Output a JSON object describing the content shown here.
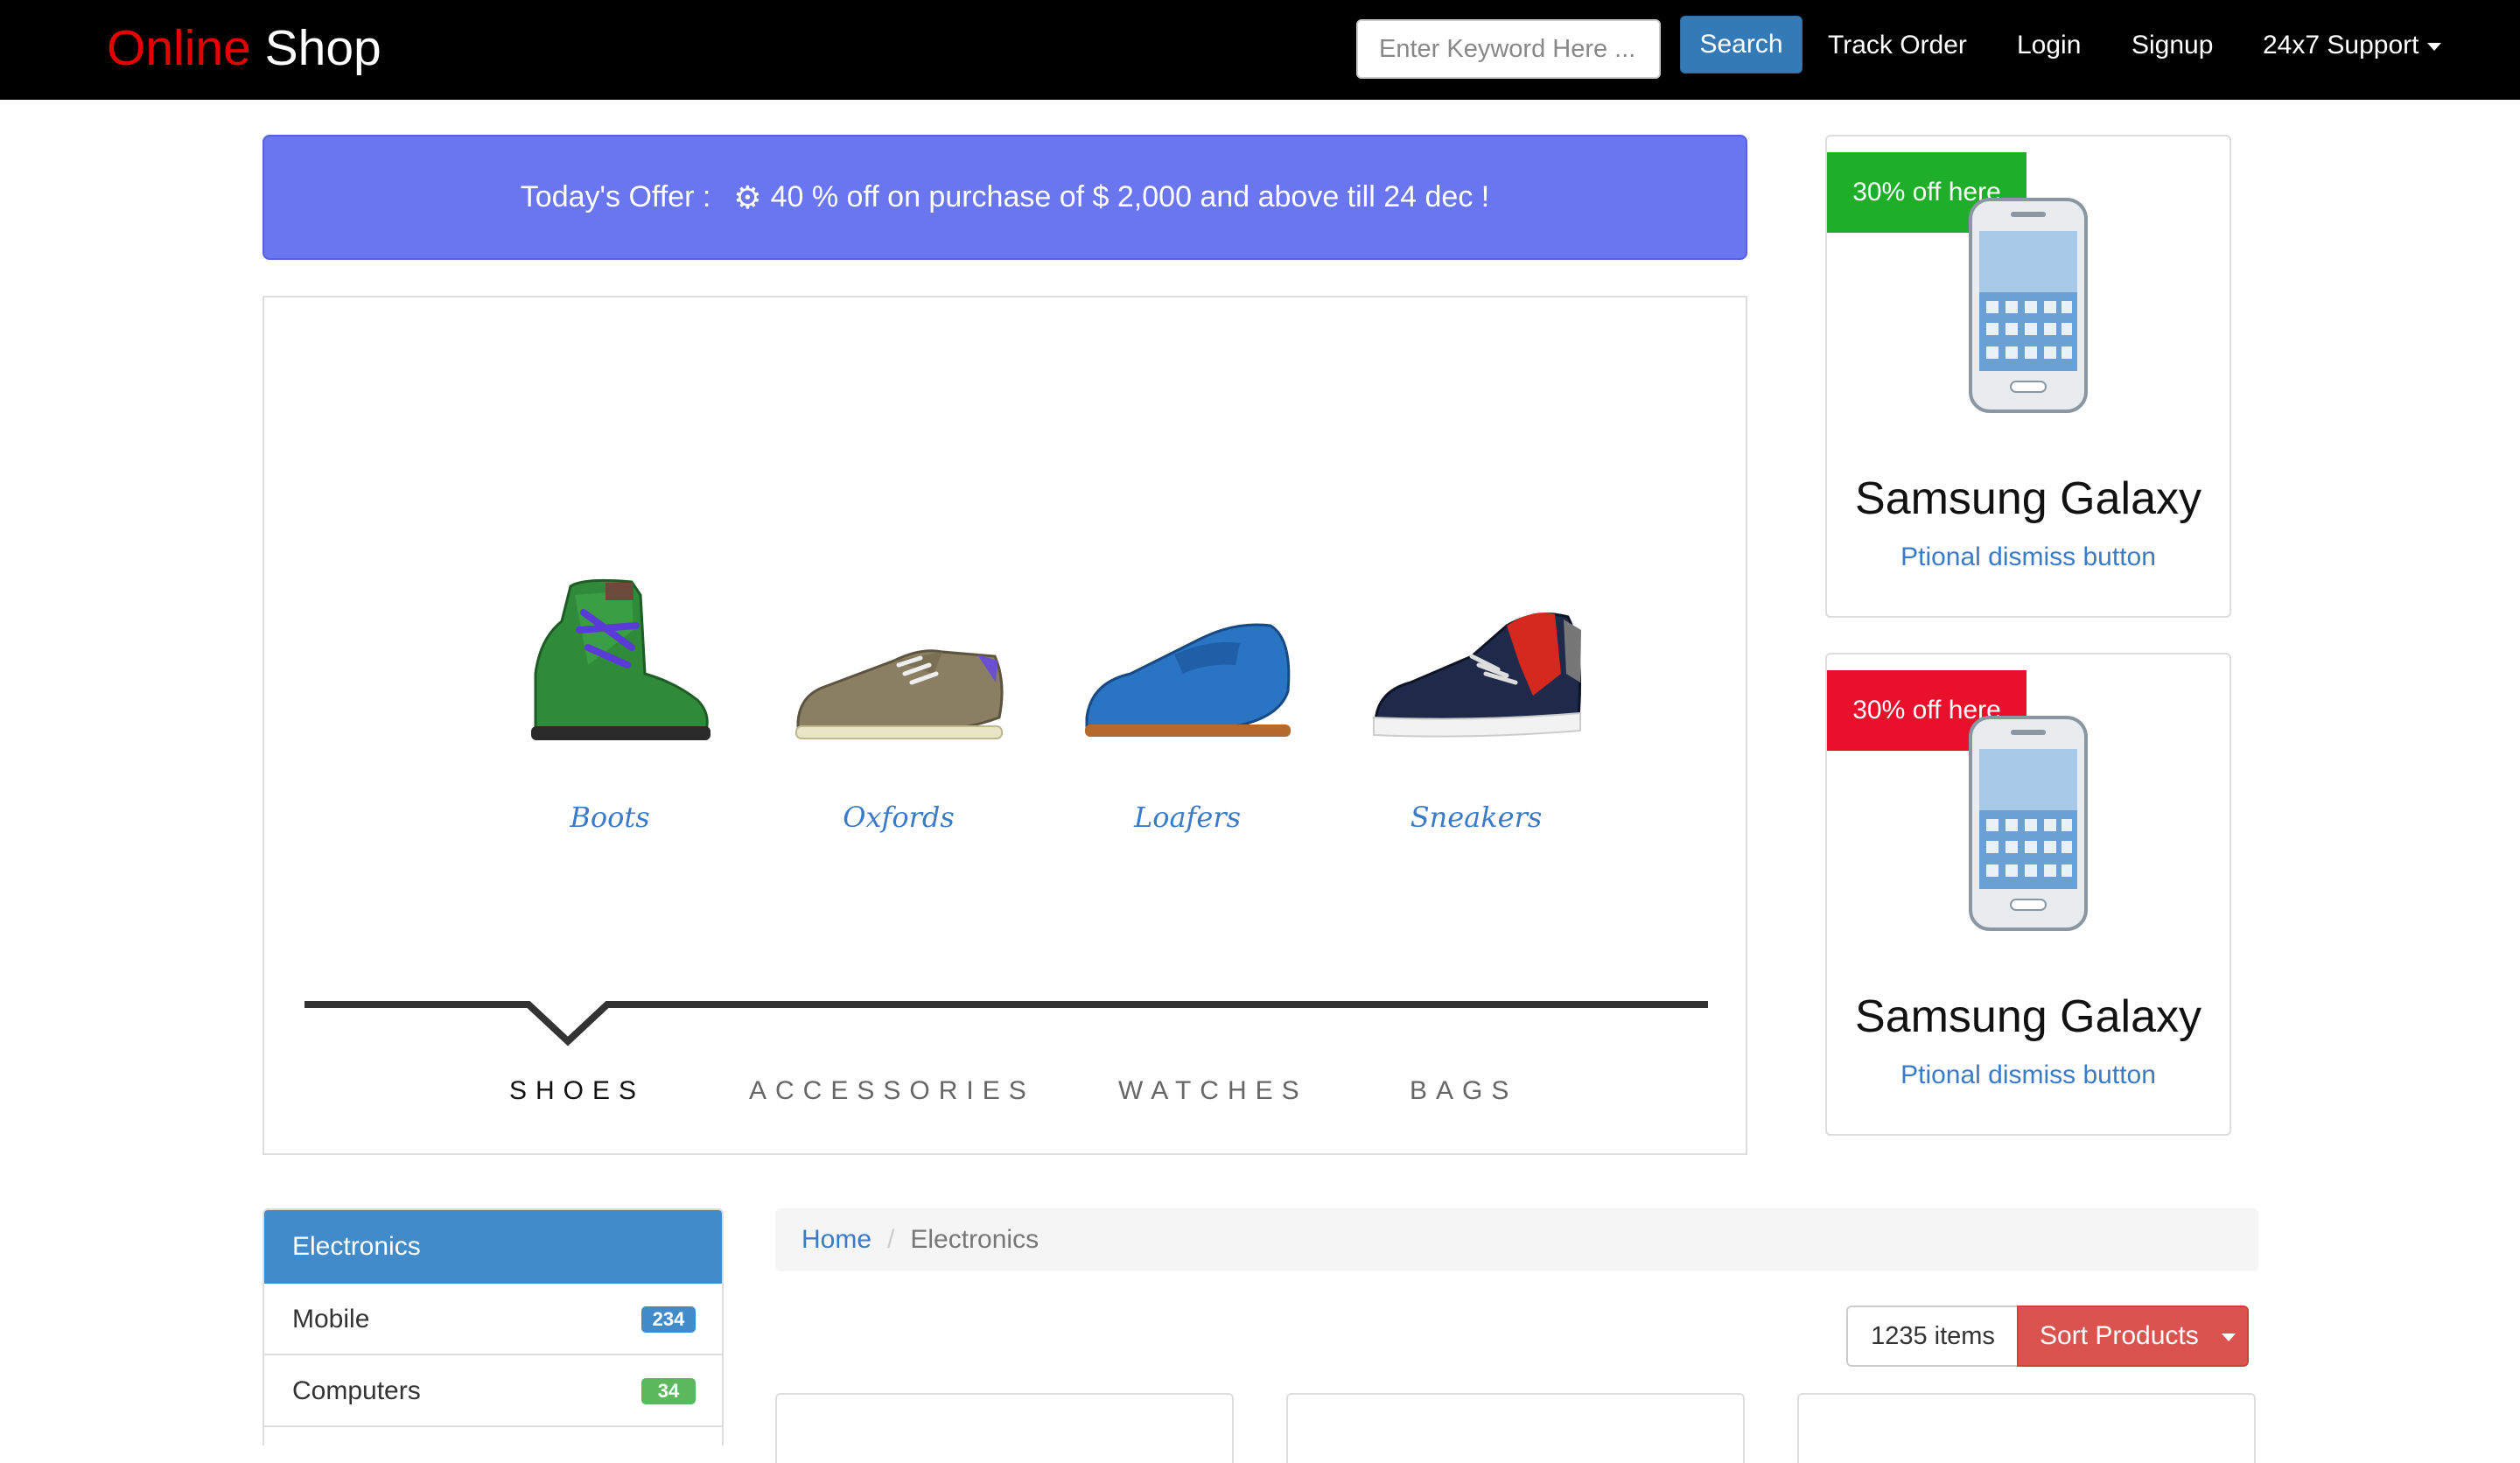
{
  "navbar": {
    "brand_accent": "Online",
    "brand_rest": " Shop",
    "search_placeholder": "Enter Keyword Here ...",
    "search_button": "Search",
    "links": {
      "track_order": "Track Order",
      "login": "Login",
      "signup": "Signup",
      "support": "24x7 Support"
    }
  },
  "offer": {
    "label": "Today's Offer :",
    "text": "40 % off on purchase of $ 2,000 and above till 24 dec !"
  },
  "carousel": {
    "products": [
      {
        "name": "Boots"
      },
      {
        "name": "Oxfords"
      },
      {
        "name": "Loafers"
      },
      {
        "name": "Sneakers"
      }
    ],
    "tabs": [
      "SHOES",
      "ACCESSORIES",
      "WATCHES",
      "BAGS"
    ],
    "active_tab": "SHOES"
  },
  "ads": [
    {
      "badge": "30% off here",
      "badge_color": "#1fae2a",
      "title": "Samsung Galaxy",
      "link": "Ptional dismiss button"
    },
    {
      "badge": "30% off here",
      "badge_color": "#e8102a",
      "title": "Samsung Galaxy",
      "link": "Ptional dismiss button"
    }
  ],
  "categories": {
    "header": "Electronics",
    "items": [
      {
        "label": "Mobile",
        "count": "234",
        "color": "#428bca"
      },
      {
        "label": "Computers",
        "count": "34",
        "color": "#5cb85c"
      },
      {
        "label": "",
        "count": "",
        "color": "#d9534f"
      }
    ]
  },
  "breadcrumb": {
    "home": "Home",
    "separator": "/",
    "current": "Electronics"
  },
  "sort": {
    "count_label": "1235 items",
    "button": "Sort Products"
  },
  "colors": {
    "brand_accent": "#e60000",
    "primary": "#337ab7",
    "offer_bg": "#6a75f0",
    "danger": "#d9534f"
  }
}
